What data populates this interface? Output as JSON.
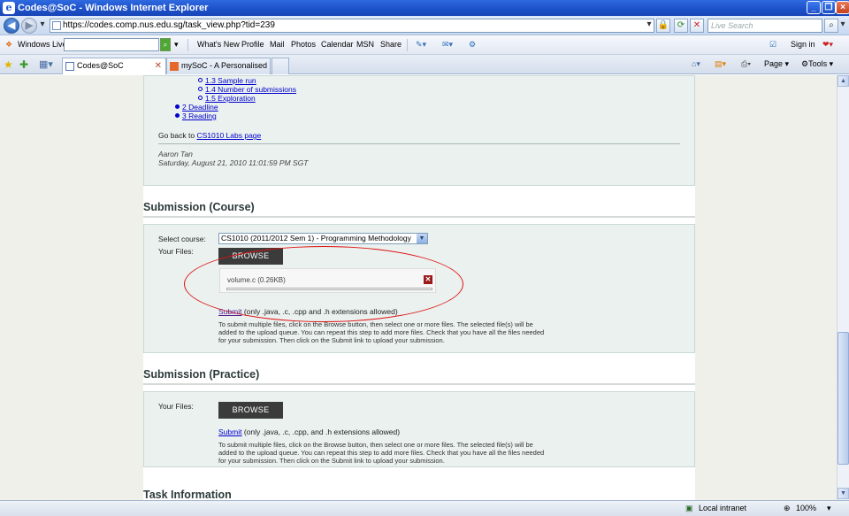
{
  "window": {
    "title": "Codes@SoC - Windows Internet Explorer"
  },
  "address": {
    "url": "https://codes.comp.nus.edu.sg/task_view.php?tid=239",
    "search_placeholder": "Live Search"
  },
  "live_toolbar": {
    "brand": "Windows Live",
    "items": [
      "What's New",
      "Profile",
      "Mail",
      "Photos",
      "Calendar",
      "MSN",
      "Share"
    ],
    "sign_in": "Sign in"
  },
  "tabs": [
    {
      "label": "Codes@SoC",
      "active": true
    },
    {
      "label": "mySoC - A Personalised Port...",
      "active": false
    }
  ],
  "commands": {
    "page": "Page",
    "tools": "Tools"
  },
  "toc": {
    "items": [
      {
        "label": "1.3 Sample run",
        "level": 2
      },
      {
        "label": "1.4 Number of submissions",
        "level": 2
      },
      {
        "label": "1.5 Exploration",
        "level": 2
      },
      {
        "label": "2 Deadline",
        "level": 1
      },
      {
        "label": "3 Reading",
        "level": 1
      }
    ],
    "go_back_prefix": "Go back to ",
    "go_back_link": "CS1010 Labs page",
    "author": "Aaron Tan",
    "date": "Saturday, August 21, 2010 11:01:59 PM SGT"
  },
  "course": {
    "heading": "Submission (Course)",
    "select_label": "Select course:",
    "selected_course": "CS1010 (2011/2012 Sem 1) - Programming Methodology",
    "files_label": "Your Files:",
    "browse_label": "BROWSE",
    "queued_file": "volume.c (0.26KB)",
    "progress": 0,
    "submit_link": "Submit",
    "submit_note": " (only .java, .c, .cpp and .h extensions allowed)",
    "help_text": "To submit multiple files, click on the Browse button, then select one or more files. The selected file(s) will be added to the upload queue. You can repeat this step to add more files. Check that you have all the files needed for your submission. Then click on the Submit link to upload your submission."
  },
  "practice": {
    "heading": "Submission (Practice)",
    "files_label": "Your Files:",
    "browse_label": "BROWSE",
    "submit_link": "Submit",
    "submit_note": " (only .java, .c, .cpp, and .h extensions allowed)",
    "help_text": "To submit multiple files, click on the Browse button, then select one or more files. The selected file(s) will be added to the upload queue. You can repeat this step to add more files. Check that you have all the files needed for your submission. Then click on the Submit link to upload your submission."
  },
  "task_info": {
    "heading": "Task Information"
  },
  "status": {
    "zone": "Local intranet",
    "zoom": "100%"
  },
  "colors": {
    "link": "#0000cc",
    "panel": "#eaf1ef",
    "sidebar": "#eef0e9",
    "annotation": "#dd1111",
    "browse_button": "#3b3b3b"
  }
}
